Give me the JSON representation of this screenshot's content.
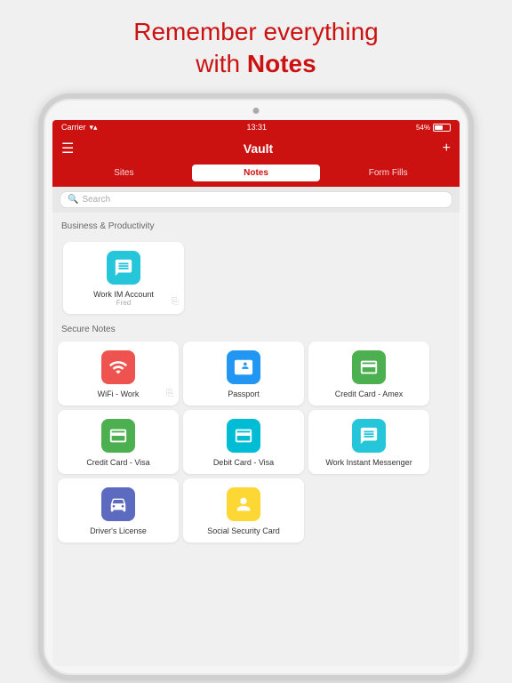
{
  "promo": {
    "line1": "Remember everything",
    "line2": "with ",
    "bold": "Notes"
  },
  "statusBar": {
    "carrier": "Carrier",
    "wifi": "📶",
    "time": "13:31",
    "battery": "54%"
  },
  "navBar": {
    "title": "Vault",
    "menuIcon": "☰",
    "addIcon": "+"
  },
  "tabs": [
    {
      "label": "Sites",
      "active": false
    },
    {
      "label": "Notes",
      "active": true
    },
    {
      "label": "Form Fills",
      "active": false
    }
  ],
  "search": {
    "placeholder": "Search"
  },
  "sections": [
    {
      "id": "business",
      "header": "Business & Productivity",
      "items": [
        {
          "id": "work-im",
          "label": "Work IM Account",
          "sublabel": "Fred",
          "iconColor": "bg-teal",
          "iconSymbol": "💬",
          "hasCopy": true
        }
      ]
    },
    {
      "id": "secure-notes",
      "header": "Secure Notes",
      "items": [
        {
          "id": "wifi-work",
          "label": "WiFi - Work",
          "sublabel": "",
          "iconColor": "bg-red",
          "iconSymbol": "📶",
          "hasCopy": true
        },
        {
          "id": "passport",
          "label": "Passport",
          "sublabel": "",
          "iconColor": "bg-blue",
          "iconSymbol": "✈",
          "hasCopy": false
        },
        {
          "id": "credit-card-amex",
          "label": "Credit Card - Amex",
          "sublabel": "",
          "iconColor": "bg-green",
          "iconSymbol": "💳",
          "hasCopy": false
        },
        {
          "id": "credit-card-visa",
          "label": "Credit Card - Visa",
          "sublabel": "",
          "iconColor": "bg-green",
          "iconSymbol": "💳",
          "hasCopy": false
        },
        {
          "id": "debit-card-visa",
          "label": "Debit Card - Visa",
          "sublabel": "",
          "iconColor": "bg-cyan",
          "iconSymbol": "💳",
          "hasCopy": false
        },
        {
          "id": "work-instant-messenger",
          "label": "Work Instant Messenger",
          "sublabel": "",
          "iconColor": "bg-teal",
          "iconSymbol": "💬",
          "hasCopy": false
        },
        {
          "id": "drivers-license",
          "label": "Driver's License",
          "sublabel": "",
          "iconColor": "bg-indigo",
          "iconSymbol": "🚗",
          "hasCopy": false
        },
        {
          "id": "social-security",
          "label": "Social Security Card",
          "sublabel": "",
          "iconColor": "bg-yellow",
          "iconSymbol": "👤",
          "hasCopy": false
        }
      ]
    }
  ]
}
